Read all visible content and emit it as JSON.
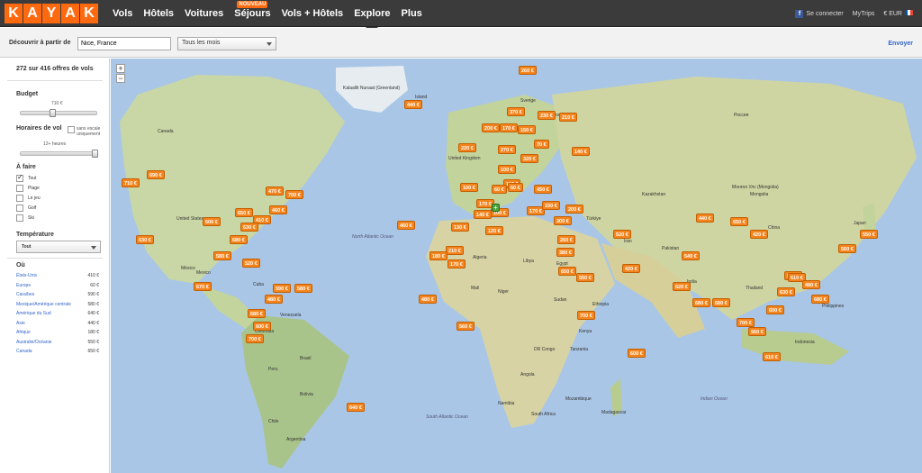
{
  "topbar": {
    "logo_letters": [
      "K",
      "A",
      "Y",
      "A",
      "K"
    ],
    "nav": [
      {
        "label": "Vols"
      },
      {
        "label": "Hôtels"
      },
      {
        "label": "Voitures"
      },
      {
        "label": "Séjours",
        "badge": "NOUVEAU"
      },
      {
        "label": "Vols + Hôtels"
      },
      {
        "label": "Explore",
        "active": true
      },
      {
        "label": "Plus"
      }
    ],
    "connect_label": "Se connecter",
    "mytrips_label": "MyTrips",
    "currency_label": "€ EUR"
  },
  "search": {
    "from_label": "Découvrir à partir de",
    "from_value": "Nice, France",
    "month_value": "Tous les mois",
    "send_label": "Envoyer"
  },
  "sidebar": {
    "results_count": "272 sur 416 offres de vols",
    "budget_label": "Budget",
    "budget_value": "710 €",
    "budget_level": 0.4,
    "flight_time_label": "Horaires de vol",
    "flight_time_option": "sans escale uniquement",
    "flight_time_value": "12+ heures",
    "flight_time_level": 1.0,
    "activities_label": "À faire",
    "activities": [
      {
        "label": "Tout",
        "checked": true
      },
      {
        "label": "Plage",
        "checked": false
      },
      {
        "label": "Le jeu",
        "checked": false
      },
      {
        "label": "Golf",
        "checked": false
      },
      {
        "label": "Ski",
        "checked": false
      }
    ],
    "temperature_label": "Température",
    "temperature_value": "Tout",
    "regions_label": "Où",
    "regions": [
      {
        "name": "États-Unis",
        "price": "410 €"
      },
      {
        "name": "Europe",
        "price": "60 €"
      },
      {
        "name": "Caraïbes",
        "price": "590 €"
      },
      {
        "name": "Mexique/Amérique centrale",
        "price": "580 €"
      },
      {
        "name": "Amérique du Sud",
        "price": "640 €"
      },
      {
        "name": "Asie",
        "price": "440 €"
      },
      {
        "name": "Afrique",
        "price": "180 €"
      },
      {
        "name": "Australie/Océanie",
        "price": "550 €"
      },
      {
        "name": "Canada",
        "price": "650 €"
      }
    ]
  },
  "map": {
    "zoom_in": "+",
    "zoom_out": "−",
    "origin_label": "+",
    "labels": [
      {
        "text": "Kalaallit Nunaat (Greenland)",
        "ocean": false
      },
      {
        "text": "Island",
        "ocean": false
      },
      {
        "text": "Sverige",
        "ocean": false
      },
      {
        "text": "Suomi",
        "ocean": false
      },
      {
        "text": "Россия",
        "ocean": false
      },
      {
        "text": "Canada",
        "ocean": false
      },
      {
        "text": "United States",
        "ocean": false
      },
      {
        "text": "México",
        "ocean": false
      },
      {
        "text": "North Atlantic Ocean",
        "ocean": true
      },
      {
        "text": "United Kingdom",
        "ocean": false
      },
      {
        "text": "Kazakhstan",
        "ocean": false
      },
      {
        "text": "Монгол Улс (Mongolia)",
        "ocean": false
      },
      {
        "text": "China",
        "ocean": false
      },
      {
        "text": "Türkiye",
        "ocean": false
      },
      {
        "text": "India",
        "ocean": false
      },
      {
        "text": "Mali",
        "ocean": false
      },
      {
        "text": "Niger",
        "ocean": false
      },
      {
        "text": "DR Congo",
        "ocean": false
      },
      {
        "text": "Angola",
        "ocean": false
      },
      {
        "text": "Brasil",
        "ocean": false
      },
      {
        "text": "Colombia",
        "ocean": false
      },
      {
        "text": "Peru",
        "ocean": false
      },
      {
        "text": "Bolivia",
        "ocean": false
      },
      {
        "text": "Argentina",
        "ocean": false
      },
      {
        "text": "Chile",
        "ocean": false
      },
      {
        "text": "South Atlantic Ocean",
        "ocean": true
      },
      {
        "text": "Indian Ocean",
        "ocean": true
      },
      {
        "text": "Indonesia",
        "ocean": false
      },
      {
        "text": "Philippines",
        "ocean": false
      },
      {
        "text": "Mongolia",
        "ocean": false
      },
      {
        "text": "Venezuela",
        "ocean": false
      },
      {
        "text": "Algeria",
        "ocean": false
      },
      {
        "text": "Libya",
        "ocean": false
      },
      {
        "text": "Egypt",
        "ocean": false
      },
      {
        "text": "Sudan",
        "ocean": false
      },
      {
        "text": "South Africa",
        "ocean": false
      },
      {
        "text": "Namibia",
        "ocean": false
      },
      {
        "text": "Mozambique",
        "ocean": false
      },
      {
        "text": "Madagascar",
        "ocean": false
      },
      {
        "text": "Tanzania",
        "ocean": false
      },
      {
        "text": "Kenya",
        "ocean": false
      },
      {
        "text": "Ethiopia",
        "ocean": false
      },
      {
        "text": "Iran",
        "ocean": false
      },
      {
        "text": "Pakistan",
        "ocean": false
      },
      {
        "text": "Thailand",
        "ocean": false
      },
      {
        "text": "Japan",
        "ocean": false
      },
      {
        "text": "Mexico",
        "ocean": false
      },
      {
        "text": "Cuba",
        "ocean": false
      }
    ],
    "price_tags": [
      "260 €",
      "440 €",
      "370 €",
      "200 €",
      "170 €",
      "150 €",
      "230 €",
      "210 €",
      "70 €",
      "140 €",
      "270 €",
      "320 €",
      "100 €",
      "110 €",
      "220 €",
      "690 €",
      "710 €",
      "470 €",
      "700 €",
      "630 €",
      "460 €",
      "410 €",
      "600 €",
      "650 €",
      "630 €",
      "680 €",
      "520 €",
      "580 €",
      "670 €",
      "590 €",
      "580 €",
      "680 €",
      "600 €",
      "480 €",
      "700 €",
      "640 €",
      "100 €",
      "60 €",
      "60 €",
      "170 €",
      "100 €",
      "130 €",
      "140 €",
      "120 €",
      "260 €",
      "380 €",
      "450 €",
      "210 €",
      "180 €",
      "170 €",
      "650 €",
      "550 €",
      "460 €",
      "200 €",
      "170 €",
      "150 €",
      "300 €",
      "700 €",
      "560 €",
      "480 €",
      "420 €",
      "520 €",
      "540 €",
      "620 €",
      "680 €",
      "680 €",
      "600 €",
      "700 €",
      "560 €",
      "610 €",
      "560 €",
      "550 €",
      "560 €",
      "610 €",
      "680 €",
      "630 €",
      "480 €",
      "600 €",
      "650 €",
      "420 €",
      "440 €"
    ]
  }
}
